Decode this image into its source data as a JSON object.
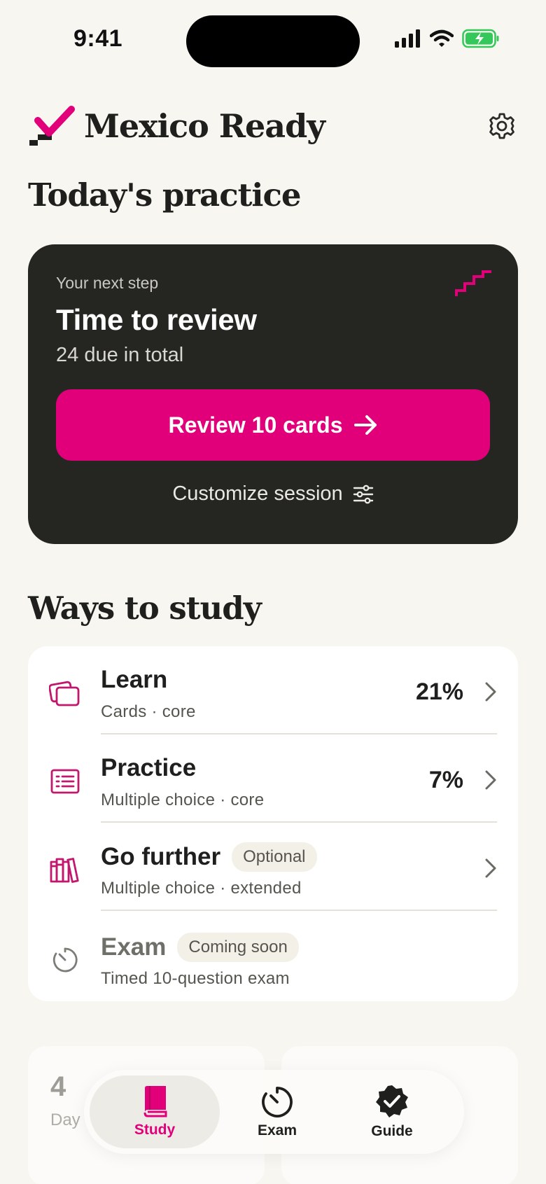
{
  "status_bar": {
    "time": "9:41"
  },
  "header": {
    "title": "Mexico Ready"
  },
  "todays_practice": {
    "heading": "Today's practice",
    "eyebrow": "Your next step",
    "title": "Time to review",
    "subtitle": "24 due in total",
    "primary_button": "Review 10 cards",
    "customize_label": "Customize session"
  },
  "ways": {
    "heading": "Ways to study",
    "items": [
      {
        "title": "Learn",
        "subtitle": "Cards · core",
        "percent": "21%",
        "icon": "cards-icon"
      },
      {
        "title": "Practice",
        "subtitle": "Multiple choice · core",
        "percent": "7%",
        "icon": "list-icon"
      },
      {
        "title": "Go further",
        "badge": "Optional",
        "subtitle": "Multiple choice · extended",
        "icon": "books-icon"
      },
      {
        "title": "Exam",
        "badge": "Coming soon",
        "subtitle": "Timed 10-question exam",
        "icon": "timer-icon"
      }
    ]
  },
  "stats_preview": {
    "value": "4",
    "label": "Day"
  },
  "bottom_nav": {
    "items": [
      {
        "label": "Study",
        "active": true
      },
      {
        "label": "Exam",
        "active": false
      },
      {
        "label": "Guide",
        "active": false
      }
    ]
  },
  "colors": {
    "accent": "#e1007a",
    "dark_card": "#252622",
    "background": "#f8f6f1"
  }
}
